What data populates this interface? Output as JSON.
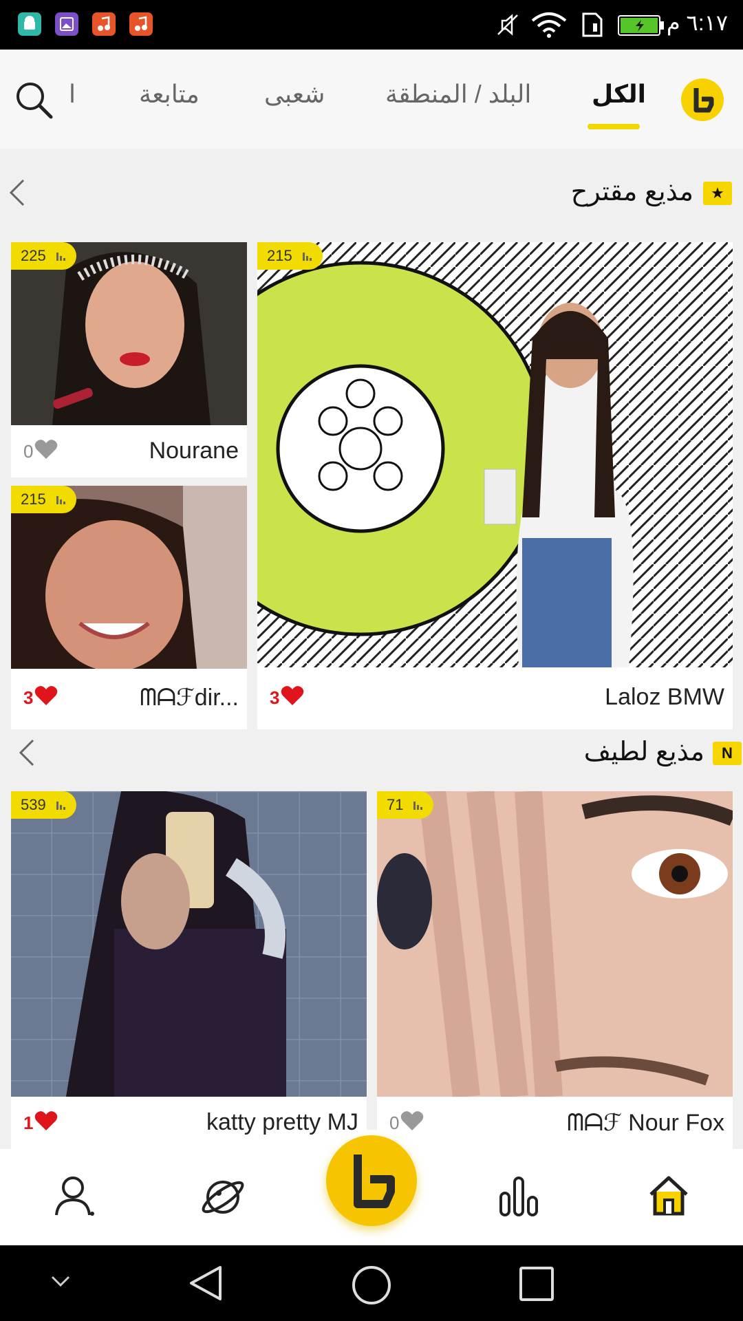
{
  "status_bar": {
    "time": "٦:١٧ م",
    "app_icons": [
      {
        "name": "android-app-icon",
        "color": "#2fb7a8"
      },
      {
        "name": "gallery-app-icon",
        "color": "#7c4fc9"
      },
      {
        "name": "music-app-icon",
        "color": "#e8542a"
      },
      {
        "name": "music-app-icon-2",
        "color": "#e8542a"
      }
    ],
    "battery_color": "#56c52a"
  },
  "top_nav": {
    "tabs": [
      {
        "label": "الكل",
        "active": true
      },
      {
        "label": "البلد / المنطقة",
        "active": false
      },
      {
        "label": "شعبى",
        "active": false
      },
      {
        "label": "متابعة",
        "active": false
      },
      {
        "label": "ا",
        "active": false
      }
    ],
    "accent": "#f2d800"
  },
  "sections": [
    {
      "title": "مذيع مقترح",
      "badge": "★",
      "cards": [
        {
          "name": "Laloz BMW",
          "likes": "3",
          "viewers": "215",
          "has_likes": true
        },
        {
          "name": "Nourane",
          "likes": "0",
          "viewers": "225",
          "has_likes": false
        },
        {
          "name": "ᗰᗩℱdir...",
          "likes": "3",
          "viewers": "215",
          "has_likes": true
        }
      ]
    },
    {
      "title": "مذيع لطيف",
      "badge": "N",
      "cards": [
        {
          "name": "ᗰᗩℱ Nour Fox",
          "likes": "0",
          "viewers": "71",
          "has_likes": false
        },
        {
          "name": "katty pretty MJ",
          "likes": "1",
          "viewers": "539",
          "has_likes": true
        }
      ]
    }
  ],
  "bottom_nav": {
    "items": [
      "home-icon",
      "ranking-icon",
      "live-center-icon",
      "explore-planet-icon",
      "profile-icon"
    ]
  }
}
